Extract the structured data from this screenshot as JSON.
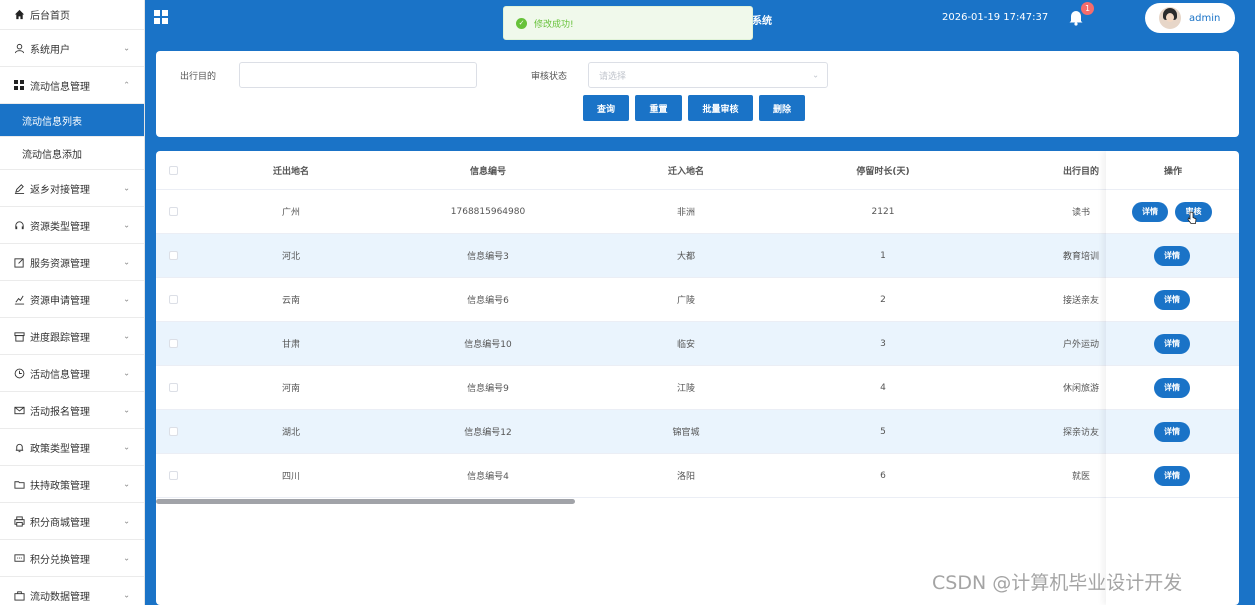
{
  "sidebar": {
    "home": "后台首页",
    "items": [
      {
        "label": "系统用户",
        "icon": "user-icon"
      },
      {
        "label": "流动信息管理",
        "icon": "grid-icon",
        "expanded": true
      },
      {
        "label": "返乡对接管理",
        "icon": "edit-icon"
      },
      {
        "label": "资源类型管理",
        "icon": "headset-icon"
      },
      {
        "label": "服务资源管理",
        "icon": "doc-edit-icon"
      },
      {
        "label": "资源申请管理",
        "icon": "chart-icon"
      },
      {
        "label": "进度跟踪管理",
        "icon": "box-icon"
      },
      {
        "label": "活动信息管理",
        "icon": "clock-icon"
      },
      {
        "label": "活动报名管理",
        "icon": "mail-icon"
      },
      {
        "label": "政策类型管理",
        "icon": "bell-icon"
      },
      {
        "label": "扶持政策管理",
        "icon": "folder-icon"
      },
      {
        "label": "积分商城管理",
        "icon": "printer-icon"
      },
      {
        "label": "积分兑换管理",
        "icon": "message-icon"
      },
      {
        "label": "流动数据管理",
        "icon": "stats-icon"
      }
    ],
    "submenu": [
      "流动信息列表",
      "流动信息添加"
    ]
  },
  "header": {
    "title_fragment": "系统",
    "datetime": "2026-01-19 17:47:37",
    "notification_count": "1",
    "username": "admin"
  },
  "toast": {
    "message": "修改成功!"
  },
  "search": {
    "purpose_label": "出行目的",
    "purpose_value": "",
    "status_label": "审核状态",
    "status_placeholder": "请选择",
    "buttons": [
      "查询",
      "重置",
      "批量审核",
      "删除"
    ]
  },
  "table": {
    "columns": [
      "迁出地名",
      "信息编号",
      "迁入地名",
      "停留时长(天)",
      "出行目的",
      "操作"
    ],
    "rows": [
      [
        "广州",
        "1768815964980",
        "非洲",
        "2121",
        "读书"
      ],
      [
        "河北",
        "信息编号3",
        "大都",
        "1",
        "教育培训"
      ],
      [
        "云南",
        "信息编号6",
        "广陵",
        "2",
        "接送亲友"
      ],
      [
        "甘肃",
        "信息编号10",
        "临安",
        "3",
        "户外运动"
      ],
      [
        "河南",
        "信息编号9",
        "江陵",
        "4",
        "休闲旅游"
      ],
      [
        "湖北",
        "信息编号12",
        "锦官城",
        "5",
        "探亲访友"
      ],
      [
        "四川",
        "信息编号4",
        "洛阳",
        "6",
        "就医"
      ]
    ],
    "detail_label": "详情",
    "review_label": "审核"
  },
  "watermark": "CSDN @计算机毕业设计开发",
  "colors": {
    "primary": "#1a73c7",
    "success": "#67c23a",
    "stripe": "#eaf4fd"
  }
}
